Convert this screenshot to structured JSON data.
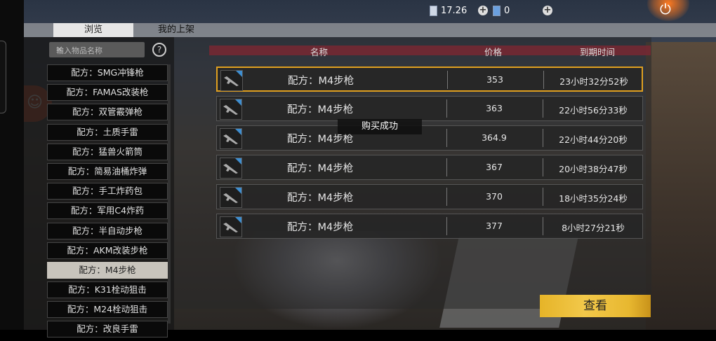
{
  "topbar": {
    "currency1": "17.26",
    "currency2": "0"
  },
  "tabs": [
    {
      "label": "浏览",
      "active": true
    },
    {
      "label": "我的上架",
      "active": false
    }
  ],
  "search": {
    "placeholder": "输入物品名称"
  },
  "sidebar": {
    "items": [
      "配方：SMG冲锋枪",
      "配方：FAMAS改装枪",
      "配方：双管霰弹枪",
      "配方：土质手雷",
      "配方：猛兽火箭筒",
      "配方：简易油桶炸弹",
      "配方：手工炸药包",
      "配方：军用C4炸药",
      "配方：半自动步枪",
      "配方：AKM改装步枪",
      "配方：M4步枪",
      "配方：K31栓动狙击",
      "配方：M24栓动狙击",
      "配方：改良手雷"
    ],
    "selected_index": 10
  },
  "table": {
    "headers": {
      "name": "名称",
      "price": "价格",
      "expiry": "到期时间"
    },
    "rows": [
      {
        "name": "配方：M4步枪",
        "price": "353",
        "expiry": "23小时32分52秒"
      },
      {
        "name": "配方：M4步枪",
        "price": "363",
        "expiry": "22小时56分33秒"
      },
      {
        "name": "配方：M4步枪",
        "price": "364.9",
        "expiry": "22小时44分20秒"
      },
      {
        "name": "配方：M4步枪",
        "price": "367",
        "expiry": "20小时38分47秒"
      },
      {
        "name": "配方：M4步枪",
        "price": "370",
        "expiry": "18小时35分24秒"
      },
      {
        "name": "配方：M4步枪",
        "price": "377",
        "expiry": "8小时27分21秒"
      }
    ],
    "selected_row": 0
  },
  "toast": "购买成功",
  "view_button": "查看",
  "colors": {
    "selected_border": "#e0a020",
    "button": "#f2c84a",
    "header_band": "#7a2832"
  }
}
